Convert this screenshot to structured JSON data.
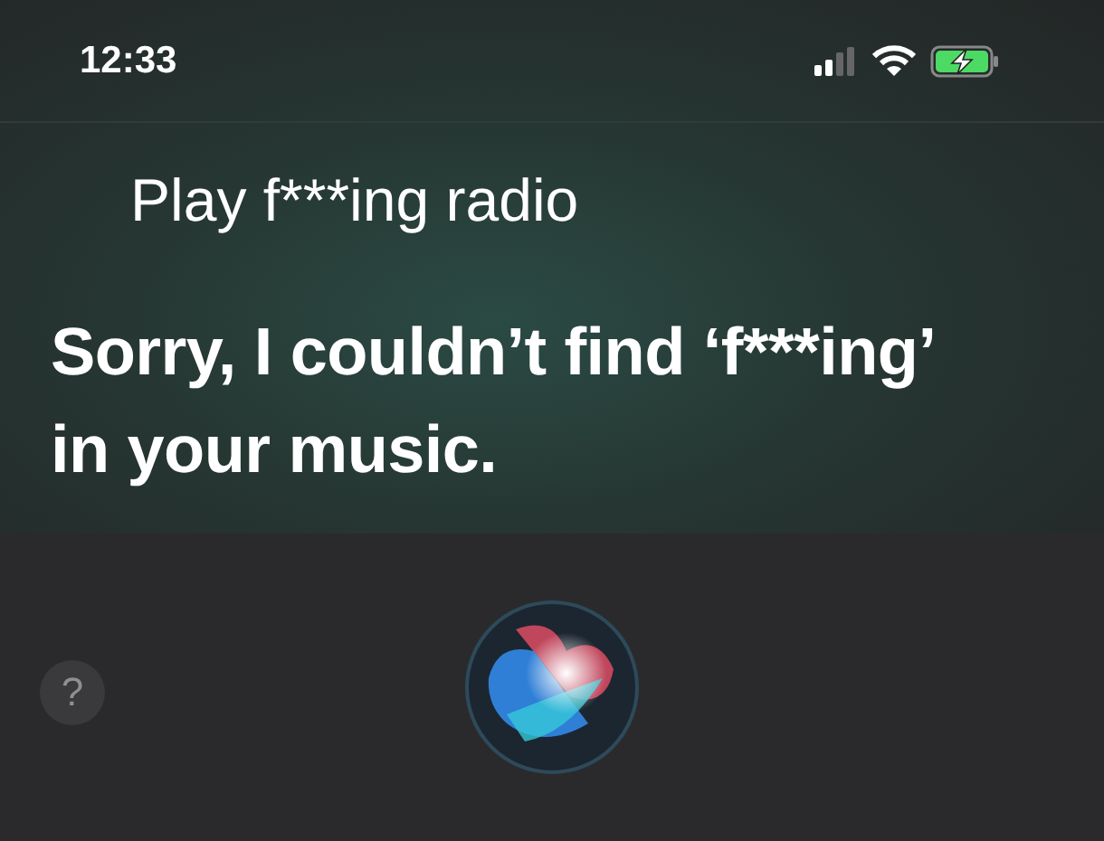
{
  "status_bar": {
    "time": "12:33"
  },
  "query": "Play f***ing radio",
  "response": "Sorry, I couldn’t find ‘f***ing’ in your music.",
  "help_button": "?"
}
